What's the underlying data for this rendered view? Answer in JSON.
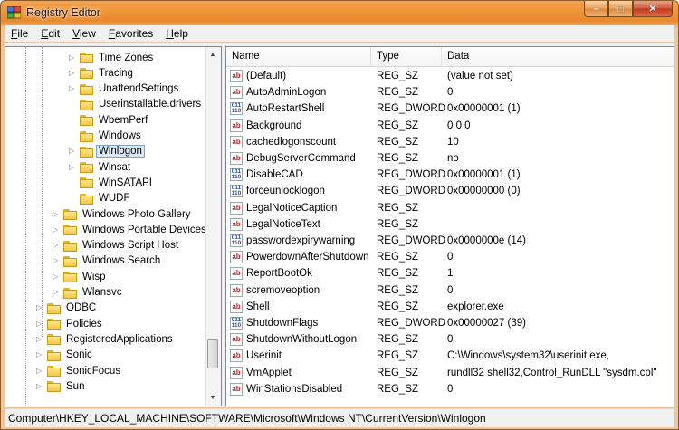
{
  "window": {
    "title": "Registry Editor"
  },
  "menu": [
    "File",
    "Edit",
    "View",
    "Favorites",
    "Help"
  ],
  "tree": {
    "items": [
      {
        "label": "Time Zones",
        "level": 2
      },
      {
        "label": "Tracing",
        "level": 2
      },
      {
        "label": "UnattendSettings",
        "level": 2
      },
      {
        "label": "Userinstallable.drivers",
        "level": 2
      },
      {
        "label": "WbemPerf",
        "level": 2
      },
      {
        "label": "Windows",
        "level": 2
      },
      {
        "label": "Winlogon",
        "level": 2,
        "selected": true
      },
      {
        "label": "Winsat",
        "level": 2
      },
      {
        "label": "WinSATAPI",
        "level": 2
      },
      {
        "label": "WUDF",
        "level": 2
      },
      {
        "label": "Windows Photo Gallery",
        "level": 1
      },
      {
        "label": "Windows Portable Devices",
        "level": 1
      },
      {
        "label": "Windows Script Host",
        "level": 1
      },
      {
        "label": "Windows Search",
        "level": 1
      },
      {
        "label": "Wisp",
        "level": 1
      },
      {
        "label": "Wlansvc",
        "level": 1
      },
      {
        "label": "ODBC",
        "level": 0
      },
      {
        "label": "Policies",
        "level": 0
      },
      {
        "label": "RegisteredApplications",
        "level": 0
      },
      {
        "label": "Sonic",
        "level": 0
      },
      {
        "label": "SonicFocus",
        "level": 0
      },
      {
        "label": "Sun",
        "level": 0
      }
    ]
  },
  "columns": {
    "name": "Name",
    "type": "Type",
    "data": "Data"
  },
  "values": [
    {
      "name": "(Default)",
      "type": "REG_SZ",
      "data": "(value not set)",
      "icon": "sz"
    },
    {
      "name": "AutoAdminLogon",
      "type": "REG_SZ",
      "data": "0",
      "icon": "sz"
    },
    {
      "name": "AutoRestartShell",
      "type": "REG_DWORD",
      "data": "0x00000001 (1)",
      "icon": "dw"
    },
    {
      "name": "Background",
      "type": "REG_SZ",
      "data": "0 0 0",
      "icon": "sz"
    },
    {
      "name": "cachedlogonscount",
      "type": "REG_SZ",
      "data": "10",
      "icon": "sz"
    },
    {
      "name": "DebugServerCommand",
      "type": "REG_SZ",
      "data": "no",
      "icon": "sz"
    },
    {
      "name": "DisableCAD",
      "type": "REG_DWORD",
      "data": "0x00000001 (1)",
      "icon": "dw"
    },
    {
      "name": "forceunlocklogon",
      "type": "REG_DWORD",
      "data": "0x00000000 (0)",
      "icon": "dw"
    },
    {
      "name": "LegalNoticeCaption",
      "type": "REG_SZ",
      "data": "",
      "icon": "sz"
    },
    {
      "name": "LegalNoticeText",
      "type": "REG_SZ",
      "data": "",
      "icon": "sz"
    },
    {
      "name": "passwordexpirywarning",
      "type": "REG_DWORD",
      "data": "0x0000000e (14)",
      "icon": "dw"
    },
    {
      "name": "PowerdownAfterShutdown",
      "type": "REG_SZ",
      "data": "0",
      "icon": "sz"
    },
    {
      "name": "ReportBootOk",
      "type": "REG_SZ",
      "data": "1",
      "icon": "sz"
    },
    {
      "name": "scremoveoption",
      "type": "REG_SZ",
      "data": "0",
      "icon": "sz"
    },
    {
      "name": "Shell",
      "type": "REG_SZ",
      "data": "explorer.exe",
      "icon": "sz"
    },
    {
      "name": "ShutdownFlags",
      "type": "REG_DWORD",
      "data": "0x00000027 (39)",
      "icon": "dw"
    },
    {
      "name": "ShutdownWithoutLogon",
      "type": "REG_SZ",
      "data": "0",
      "icon": "sz"
    },
    {
      "name": "Userinit",
      "type": "REG_SZ",
      "data": "C:\\Windows\\system32\\userinit.exe,",
      "icon": "sz"
    },
    {
      "name": "VmApplet",
      "type": "REG_SZ",
      "data": "rundll32 shell32,Control_RunDLL \"sysdm.cpl\"",
      "icon": "sz"
    },
    {
      "name": "WinStationsDisabled",
      "type": "REG_SZ",
      "data": "0",
      "icon": "sz"
    }
  ],
  "status": {
    "path": "Computer\\HKEY_LOCAL_MACHINE\\SOFTWARE\\Microsoft\\Windows NT\\CurrentVersion\\Winlogon"
  },
  "icons": {
    "app": "registry-editor-icon",
    "minimize": "minimize-icon",
    "maximize": "maximize-icon",
    "close": "close-icon",
    "folder": "folder-icon",
    "expand": "expand-arrow-icon",
    "string_value": "string-value-icon",
    "binary_value": "dword-value-icon"
  }
}
